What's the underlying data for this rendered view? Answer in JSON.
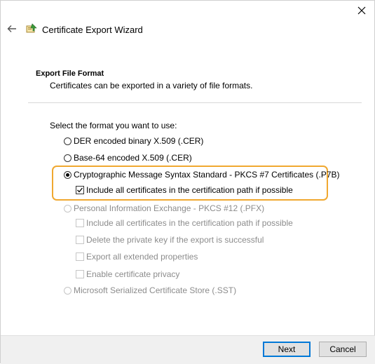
{
  "window": {
    "title": "Certificate Export Wizard"
  },
  "section": {
    "title": "Export File Format",
    "subtitle": "Certificates can be exported in a variety of file formats."
  },
  "prompt": "Select the format you want to use:",
  "options": {
    "der": {
      "label": "DER encoded binary X.509 (.CER)"
    },
    "base64": {
      "label": "Base-64 encoded X.509 (.CER)"
    },
    "pkcs7": {
      "label": "Cryptographic Message Syntax Standard - PKCS #7 Certificates (.P7B)"
    },
    "pkcs7_include": {
      "label": "Include all certificates in the certification path if possible"
    },
    "pfx": {
      "label": "Personal Information Exchange - PKCS #12 (.PFX)"
    },
    "pfx_include": {
      "label": "Include all certificates in the certification path if possible"
    },
    "pfx_delete": {
      "label": "Delete the private key if the export is successful"
    },
    "pfx_export_props": {
      "label": "Export all extended properties"
    },
    "pfx_privacy": {
      "label": "Enable certificate privacy"
    },
    "sst": {
      "label": "Microsoft Serialized Certificate Store (.SST)"
    }
  },
  "buttons": {
    "next": "Next",
    "cancel": "Cancel"
  },
  "colors": {
    "highlight": "#f0a830",
    "accent": "#0078d7"
  }
}
